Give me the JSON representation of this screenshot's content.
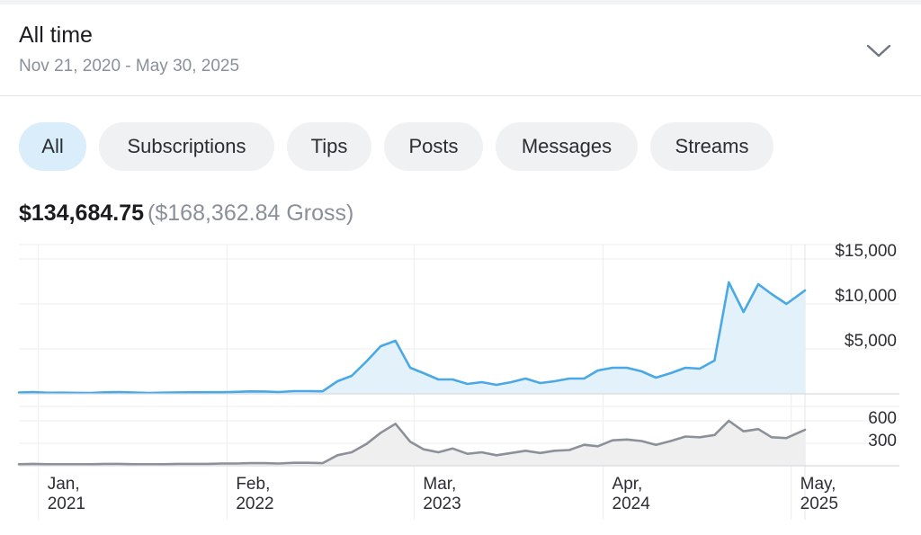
{
  "header": {
    "title": "All time",
    "date_range": "Nov 21, 2020 - May 30, 2025",
    "chevron_icon": "chevron-down-icon"
  },
  "tabs": [
    {
      "label": "All",
      "active": true
    },
    {
      "label": "Subscriptions",
      "active": false
    },
    {
      "label": "Tips",
      "active": false
    },
    {
      "label": "Posts",
      "active": false
    },
    {
      "label": "Messages",
      "active": false
    },
    {
      "label": "Streams",
      "active": false
    }
  ],
  "totals": {
    "net": "$134,684.75",
    "gross": "($168,362.84 Gross)"
  },
  "colors": {
    "earnings_line": "#4aa8e6",
    "earnings_fill": "#e3f1fb",
    "count_line": "#8c9199",
    "count_fill": "#efeff0",
    "active_tab": "#d9edfa",
    "tab": "#f0f1f3"
  },
  "chart_data": [
    {
      "type": "area",
      "ylim": [
        0,
        15000
      ],
      "y_ticks": [
        5000,
        10000,
        15000
      ],
      "y_tick_labels": [
        "$5,000",
        "$10,000",
        "$15,000"
      ],
      "x_ticks": [
        "2021-01",
        "2022-02",
        "2023-03",
        "2024-04",
        "2025-05"
      ],
      "x_tick_labels": [
        [
          "Jan,",
          "2021"
        ],
        [
          "Feb,",
          "2022"
        ],
        [
          "Mar,",
          "2023"
        ],
        [
          "Apr,",
          "2024"
        ],
        [
          "May,",
          "2025"
        ]
      ],
      "x_range": [
        "2020-11-21",
        "2025-05-30"
      ],
      "grid": true,
      "series": [
        {
          "x": [
            "2020-11-21",
            "2020-12-21",
            "2021-01-21",
            "2021-02-21",
            "2021-03-21",
            "2021-04-21",
            "2021-05-21",
            "2021-06-21",
            "2021-07-21",
            "2021-08-21",
            "2021-09-21",
            "2021-10-21",
            "2021-11-21",
            "2021-12-21",
            "2022-01-21",
            "2022-02-21",
            "2022-03-21",
            "2022-04-21",
            "2022-05-21",
            "2022-06-21",
            "2022-07-21",
            "2022-08-21",
            "2022-09-21",
            "2022-10-21",
            "2022-11-21",
            "2022-12-21",
            "2023-01-21",
            "2023-02-21",
            "2023-03-21",
            "2023-04-21",
            "2023-05-21",
            "2023-06-21",
            "2023-07-21",
            "2023-08-21",
            "2023-09-21",
            "2023-10-21",
            "2023-11-21",
            "2023-12-21",
            "2024-01-21",
            "2024-02-21",
            "2024-03-21",
            "2024-04-21",
            "2024-05-21",
            "2024-06-21",
            "2024-07-21",
            "2024-08-21",
            "2024-09-21",
            "2024-10-21",
            "2024-11-21",
            "2024-12-21",
            "2025-01-21",
            "2025-02-21",
            "2025-03-21",
            "2025-04-21",
            "2025-05-30"
          ],
          "values": [
            150,
            200,
            120,
            130,
            110,
            100,
            170,
            200,
            150,
            100,
            130,
            160,
            170,
            180,
            180,
            220,
            270,
            260,
            200,
            300,
            300,
            280,
            1400,
            2000,
            3600,
            5300,
            5900,
            2900,
            2300,
            1600,
            1600,
            1100,
            1300,
            1000,
            1300,
            1700,
            1200,
            1400,
            1700,
            1700,
            2600,
            2900,
            2900,
            2500,
            1800,
            2300,
            2900,
            2800,
            3700,
            12400,
            9100,
            12200,
            11100,
            10000,
            11500
          ]
        }
      ]
    },
    {
      "type": "area",
      "ylim": [
        0,
        900
      ],
      "y_ticks": [
        300,
        600
      ],
      "y_tick_labels": [
        "300",
        "600"
      ],
      "grid": true,
      "series": [
        {
          "x": [
            "2020-11-21",
            "2020-12-21",
            "2021-01-21",
            "2021-02-21",
            "2021-03-21",
            "2021-04-21",
            "2021-05-21",
            "2021-06-21",
            "2021-07-21",
            "2021-08-21",
            "2021-09-21",
            "2021-10-21",
            "2021-11-21",
            "2021-12-21",
            "2022-01-21",
            "2022-02-21",
            "2022-03-21",
            "2022-04-21",
            "2022-05-21",
            "2022-06-21",
            "2022-07-21",
            "2022-08-21",
            "2022-09-21",
            "2022-10-21",
            "2022-11-21",
            "2022-12-21",
            "2023-01-21",
            "2023-02-21",
            "2023-03-21",
            "2023-04-21",
            "2023-05-21",
            "2023-06-21",
            "2023-07-21",
            "2023-08-21",
            "2023-09-21",
            "2023-10-21",
            "2023-11-21",
            "2023-12-21",
            "2024-01-21",
            "2024-02-21",
            "2024-03-21",
            "2024-04-21",
            "2024-05-21",
            "2024-06-21",
            "2024-07-21",
            "2024-08-21",
            "2024-09-21",
            "2024-10-21",
            "2024-11-21",
            "2024-12-21",
            "2025-01-21",
            "2025-02-21",
            "2025-03-21",
            "2025-04-21",
            "2025-05-30"
          ],
          "values": [
            20,
            25,
            20,
            20,
            20,
            20,
            25,
            25,
            20,
            20,
            20,
            25,
            25,
            25,
            30,
            30,
            35,
            35,
            30,
            40,
            40,
            35,
            140,
            180,
            290,
            440,
            560,
            320,
            220,
            180,
            230,
            160,
            180,
            140,
            170,
            200,
            170,
            200,
            210,
            280,
            260,
            340,
            350,
            330,
            280,
            330,
            390,
            380,
            410,
            600,
            460,
            490,
            380,
            370,
            480
          ]
        }
      ]
    }
  ]
}
